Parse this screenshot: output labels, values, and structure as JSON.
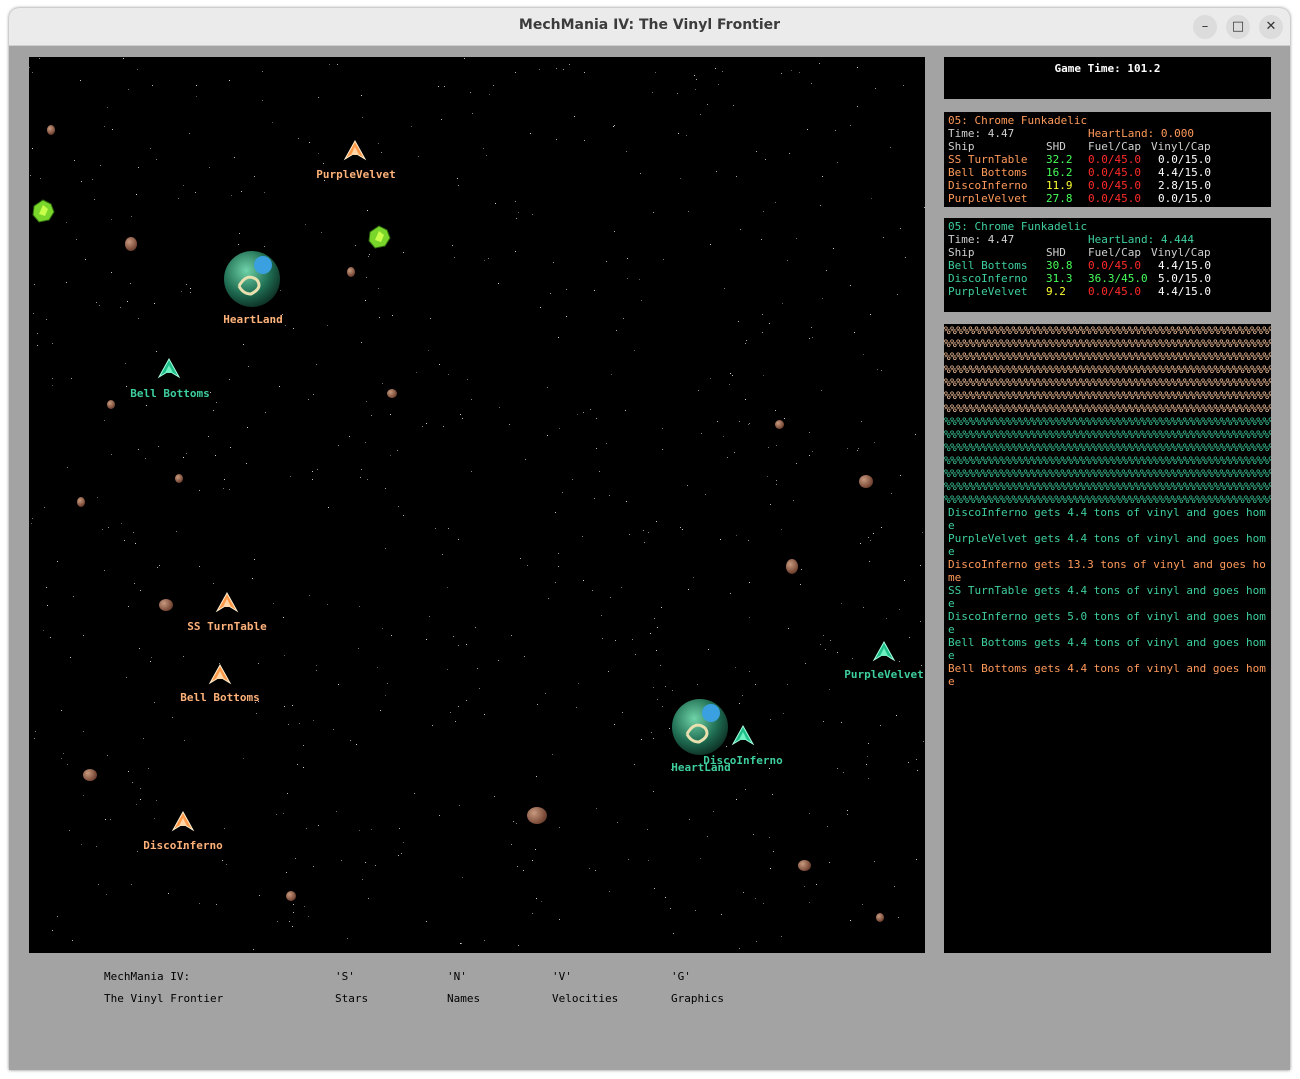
{
  "window": {
    "title": "MechMania IV: The Vinyl Frontier",
    "controls": [
      "–",
      "□",
      "✕"
    ]
  },
  "map": {
    "planets": [
      {
        "label": "HeartLand",
        "team": "orange"
      },
      {
        "label": "HeartLand",
        "team": "green"
      }
    ],
    "ships": [
      {
        "label": "PurpleVelvet",
        "team": "orange"
      },
      {
        "label": "Bell Bottoms",
        "team": "green"
      },
      {
        "label": "SS TurnTable",
        "team": "orange"
      },
      {
        "label": "Bell Bottoms",
        "team": "orange"
      },
      {
        "label": "DiscoInferno",
        "team": "orange"
      },
      {
        "label": "PurpleVelvet",
        "team": "green"
      },
      {
        "label": "DiscoInferno",
        "team": "green"
      }
    ]
  },
  "game_time": "Game Time: 101.2",
  "team1": {
    "name": "05: Chrome Funkadelic",
    "time": "Time: 4.47",
    "heartland": "HeartLand: 0.000",
    "headers": {
      "ship": "Ship",
      "shd": "SHD",
      "fuel": "Fuel/Cap",
      "vinyl": "Vinyl/Cap"
    },
    "ships": [
      {
        "name": "SS TurnTable",
        "shd": "32.2",
        "fuel": "0.0/45.0",
        "vinyl": "0.0/15.0"
      },
      {
        "name": "Bell Bottoms",
        "shd": "16.2",
        "fuel": "0.0/45.0",
        "vinyl": "4.4/15.0"
      },
      {
        "name": "DiscoInferno",
        "shd": "11.9",
        "fuel": "0.0/45.0",
        "vinyl": "2.8/15.0"
      },
      {
        "name": "PurpleVelvet",
        "shd": "27.8",
        "fuel": "0.0/45.0",
        "vinyl": "0.0/15.0"
      }
    ]
  },
  "team2": {
    "name": "05: Chrome Funkadelic",
    "time": "Time: 4.47",
    "heartland": "HeartLand: 4.444",
    "headers": {
      "ship": "Ship",
      "shd": "SHD",
      "fuel": "Fuel/Cap",
      "vinyl": "Vinyl/Cap"
    },
    "ships": [
      {
        "name": "Bell Bottoms",
        "shd": "30.8",
        "fuel": "0.0/45.0",
        "vinyl": "4.4/15.0"
      },
      {
        "name": "DiscoInferno",
        "shd": "31.3",
        "fuel": "36.3/45.0",
        "vinyl": "5.0/15.0"
      },
      {
        "name": "PurpleVelvet",
        "shd": "9.2",
        "fuel": "0.0/45.0",
        "vinyl": "4.4/15.0"
      }
    ]
  },
  "log": [
    {
      "text": "DiscoInferno gets 4.4 tons of vinyl and goes home",
      "team": "green"
    },
    {
      "text": "PurpleVelvet gets 4.4 tons of vinyl and goes home",
      "team": "green"
    },
    {
      "text": "DiscoInferno gets 13.3 tons of vinyl and goes home",
      "team": "orange"
    },
    {
      "text": "SS TurnTable gets 4.4 tons of vinyl and goes home",
      "team": "green"
    },
    {
      "text": "DiscoInferno gets 5.0 tons of vinyl and goes home",
      "team": "green"
    },
    {
      "text": "Bell Bottoms gets 4.4 tons of vinyl and goes home",
      "team": "green"
    },
    {
      "text": "Bell Bottoms gets 4.4 tons of vinyl and goes home",
      "team": "orange"
    }
  ],
  "footer": {
    "title1": "MechMania IV:",
    "title2": "The Vinyl Frontier",
    "keys": [
      {
        "key": "'S'",
        "label": "Stars"
      },
      {
        "key": "'N'",
        "label": "Names"
      },
      {
        "key": "'V'",
        "label": "Velocities"
      },
      {
        "key": "'G'",
        "label": "Graphics"
      }
    ]
  },
  "colors": {
    "orange_team": "#ffb27a",
    "green_team": "#3ecf9c",
    "space": "#000000",
    "frame": "#a3a3a3"
  }
}
